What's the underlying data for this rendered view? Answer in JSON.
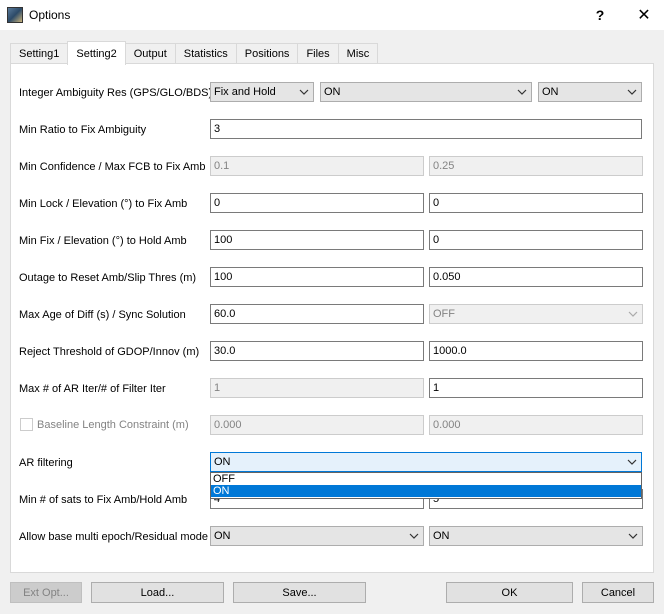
{
  "window": {
    "title": "Options",
    "help_label": "?",
    "close_label": "✕"
  },
  "tabs": [
    {
      "label": "Setting1"
    },
    {
      "label": "Setting2"
    },
    {
      "label": "Output"
    },
    {
      "label": "Statistics"
    },
    {
      "label": "Positions"
    },
    {
      "label": "Files"
    },
    {
      "label": "Misc"
    }
  ],
  "active_tab": "Setting2",
  "rows": {
    "ambiguity_res": {
      "label": "Integer Ambiguity Res (GPS/GLO/BDS)",
      "gps": "Fix and Hold",
      "glo": "ON",
      "bds": "ON"
    },
    "min_ratio": {
      "label": "Min Ratio to Fix Ambiguity",
      "value": "3"
    },
    "min_confidence": {
      "label": "Min Confidence / Max FCB to Fix Amb",
      "value1": "0.1",
      "value2": "0.25"
    },
    "min_lock": {
      "label": "Min Lock / Elevation (°) to Fix Amb",
      "value1": "0",
      "value2": "0"
    },
    "min_fix": {
      "label": "Min Fix / Elevation (°) to Hold Amb",
      "value1": "100",
      "value2": "0"
    },
    "outage": {
      "label": "Outage to Reset Amb/Slip Thres (m)",
      "value1": "100",
      "value2": "0.050"
    },
    "max_age": {
      "label": "Max Age of Diff (s) / Sync Solution",
      "value1": "60.0",
      "value2": "OFF"
    },
    "reject": {
      "label": "Reject Threshold of GDOP/Innov (m)",
      "value1": "30.0",
      "value2": "1000.0"
    },
    "ar_iter": {
      "label": "Max # of AR Iter/# of Filter Iter",
      "value1": "1",
      "value2": "1"
    },
    "baseline": {
      "label": "Baseline Length Constraint (m)",
      "value1": "0.000",
      "value2": "0.000"
    },
    "ar_filtering": {
      "label": "AR filtering",
      "value": "ON",
      "options": [
        "OFF",
        "ON"
      ]
    },
    "min_sats": {
      "label": "Min # of sats to Fix Amb/Hold Amb",
      "value1": "4",
      "value2": "5"
    },
    "allow_base": {
      "label": "Allow base multi epoch/Residual mode",
      "value1": "ON",
      "value2": "ON"
    }
  },
  "buttons": {
    "ext_opt": "Ext Opt...",
    "load": "Load...",
    "save": "Save...",
    "ok": "OK",
    "cancel": "Cancel"
  }
}
